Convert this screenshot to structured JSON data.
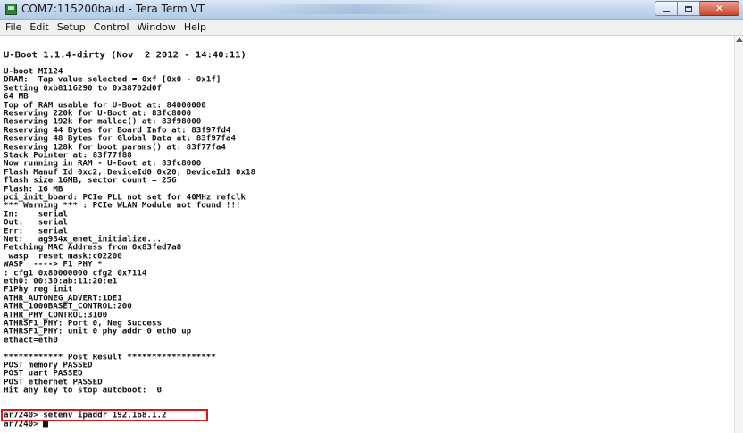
{
  "window": {
    "title": "COM7:115200baud - Tera Term VT",
    "icon": "teraterm-icon",
    "controls": [
      "minimize-icon",
      "maximize-icon",
      "close-icon"
    ],
    "close_glyph": "✕"
  },
  "menu": {
    "items": [
      "File",
      "Edit",
      "Setup",
      "Control",
      "Window",
      "Help"
    ]
  },
  "terminal": {
    "header": "U-Boot 1.1.4-dirty (Nov  2 2012 - 14:40:11)",
    "lines": [
      "U-boot MI124",
      "DRAM:  Tap value selected = 0xf [0x0 - 0x1f]",
      "Setting 0xb8116290 to 0x38702d0f",
      "64 MB",
      "Top of RAM usable for U-Boot at: 84000000",
      "Reserving 220k for U-Boot at: 83fc8000",
      "Reserving 192k for malloc() at: 83f98000",
      "Reserving 44 Bytes for Board Info at: 83f97fd4",
      "Reserving 48 Bytes for Global Data at: 83f97fa4",
      "Reserving 128k for boot params() at: 83f77fa4",
      "Stack Pointer at: 83f77f88",
      "Now running in RAM - U-Boot at: 83fc8000",
      "Flash Manuf Id 0xc2, DeviceId0 0x20, DeviceId1 0x18",
      "flash size 16MB, sector count = 256",
      "Flash: 16 MB",
      "pci_init_board: PCIe PLL not set for 40MHz refclk",
      "*** Warning *** : PCIe WLAN Module not found !!!",
      "In:    serial",
      "Out:   serial",
      "Err:   serial",
      "Net:   ag934x_enet_initialize...",
      "Fetching MAC Address from 0x83fed7a8",
      " wasp  reset mask:c02200",
      "WASP  ----> F1 PHY *",
      ": cfg1 0x80000000 cfg2 0x7114",
      "eth0: 00:30:ab:11:20:e1",
      "F1Phy reg init",
      "ATHR_AUTONEG_ADVERT:1DE1",
      "ATHR_1000BASET_CONTROL:200",
      "ATHR_PHY_CONTROL:3100",
      "ATHRSF1_PHY: Port 0, Neg Success",
      "ATHRSF1_PHY: unit 0 phy addr 0 eth0 up",
      "ethact=eth0",
      "",
      "************ Post Result ******************",
      "POST memory PASSED",
      "POST uart PASSED",
      "POST ethernet PASSED",
      "Hit any key to stop autoboot:  0"
    ],
    "command_line": "ar7240> setenv ipaddr 192.168.1.2",
    "prompt_line": "ar7240> "
  }
}
